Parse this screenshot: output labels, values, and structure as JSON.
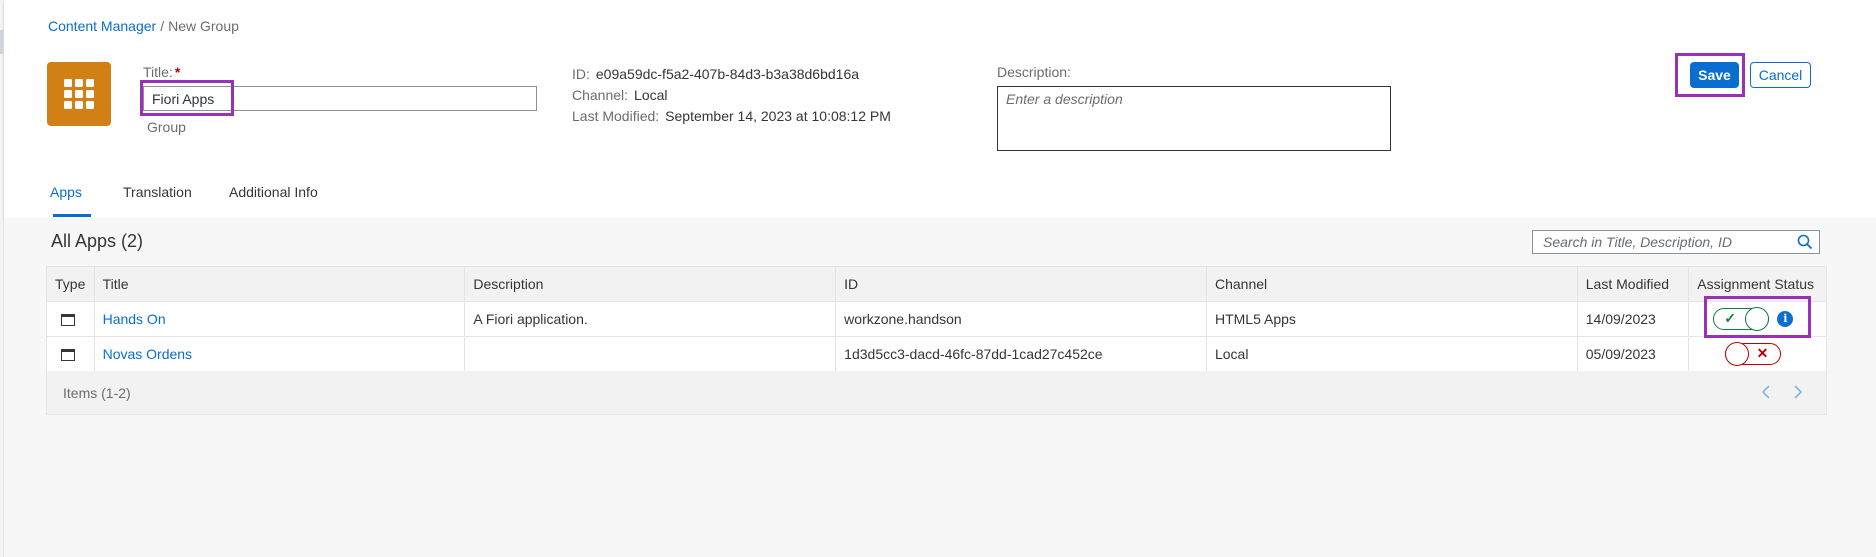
{
  "breadcrumb": {
    "root": "Content Manager",
    "separator": "/",
    "current": "New Group"
  },
  "header": {
    "icon": "app-grid-icon",
    "title_label": "Title:",
    "required_marker": "*",
    "title_value": "Fiori Apps",
    "subtitle": "Group",
    "id_label": "ID:",
    "id_value": "e09a59dc-f5a2-407b-84d3-b3a38d6bd16a",
    "channel_label": "Channel:",
    "channel_value": "Local",
    "modified_label": "Last Modified:",
    "modified_value": "September 14, 2023 at 10:08:12 PM",
    "description_label": "Description:",
    "description_placeholder": "Enter a description",
    "description_value": ""
  },
  "actions": {
    "save_label": "Save",
    "cancel_label": "Cancel"
  },
  "tabs": [
    {
      "label": "Apps",
      "active": true
    },
    {
      "label": "Translation",
      "active": false
    },
    {
      "label": "Additional Info",
      "active": false
    }
  ],
  "table": {
    "title": "All Apps (2)",
    "search_placeholder": "Search in Title, Description, ID",
    "columns": [
      "Type",
      "Title",
      "Description",
      "ID",
      "Channel",
      "Last Modified",
      "Assignment Status"
    ],
    "rows": [
      {
        "type_icon": "app-window-icon",
        "title": "Hands On",
        "description": "A Fiori application.",
        "id": "workzone.handson",
        "channel": "HTML5 Apps",
        "last_modified": "14/09/2023",
        "assigned": true,
        "status_mark": "✓",
        "has_info": true
      },
      {
        "type_icon": "app-window-icon",
        "title": "Novas Ordens",
        "description": "",
        "id": "1d3d5cc3-dacd-46fc-87dd-1cad27c452ce",
        "channel": "Local",
        "last_modified": "05/09/2023",
        "assigned": false,
        "status_mark": "✕",
        "has_info": false
      }
    ],
    "footer_items": "Items (1-2)"
  },
  "colors": {
    "accent": "#0a6ed1",
    "app_icon_bg": "#d08014",
    "highlight": "#9b30b8",
    "positive": "#107e3e",
    "negative": "#bb0000"
  }
}
